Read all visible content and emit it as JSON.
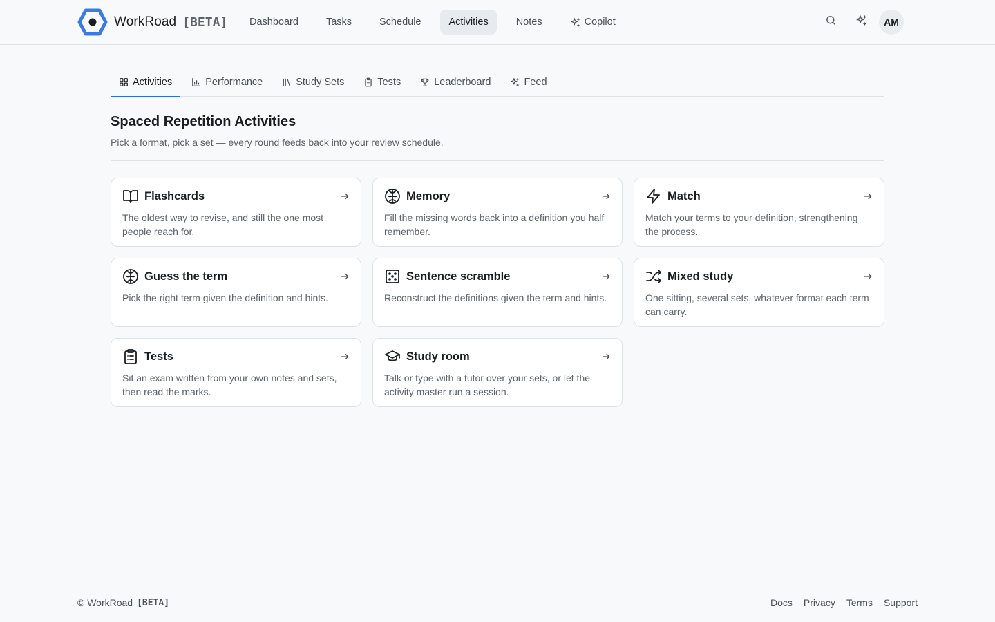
{
  "brand": {
    "name": "WorkRoad",
    "beta": "[BETA]",
    "logo_icon": "hexagon-logo",
    "accent": "#3b7be0"
  },
  "nav": {
    "items": [
      {
        "label": "Dashboard"
      },
      {
        "label": "Tasks"
      },
      {
        "label": "Schedule"
      },
      {
        "label": "Activities",
        "active": true
      },
      {
        "label": "Notes"
      },
      {
        "label": "Copilot",
        "icon": "sparkle-icon"
      }
    ]
  },
  "header_actions": {
    "search_icon": "search-icon",
    "ai_icon": "sparkle-icon",
    "avatar_initials": "AM"
  },
  "subtabs": [
    {
      "label": "Activities",
      "icon": "grid-icon",
      "active": true
    },
    {
      "label": "Performance",
      "icon": "bar-chart-icon"
    },
    {
      "label": "Study Sets",
      "icon": "library-icon"
    },
    {
      "label": "Tests",
      "icon": "clipboard-icon"
    },
    {
      "label": "Leaderboard",
      "icon": "trophy-icon"
    },
    {
      "label": "Feed",
      "icon": "sparkle-icon"
    }
  ],
  "section": {
    "title": "Spaced Repetition Activities",
    "subtitle": "Pick a format, pick a set — every round feeds back into your review schedule."
  },
  "cards": [
    {
      "title": "Flashcards",
      "icon": "book-open-icon",
      "desc": "The oldest way to revise, and still the one most people reach for."
    },
    {
      "title": "Memory",
      "icon": "brain-icon",
      "desc": "Fill the missing words back into a definition you half remember."
    },
    {
      "title": "Match",
      "icon": "lightning-icon",
      "desc": "Match your terms to your definition, strengthening the process."
    },
    {
      "title": "Guess the term",
      "icon": "brain-icon",
      "desc": "Pick the right term given the definition and hints."
    },
    {
      "title": "Sentence scramble",
      "icon": "scramble-icon",
      "desc": "Reconstruct the definitions given the term and hints."
    },
    {
      "title": "Mixed study",
      "icon": "shuffle-icon",
      "desc": "One sitting, several sets, whatever format each term can carry."
    },
    {
      "title": "Tests",
      "icon": "clipboard-list-icon",
      "desc": "Sit an exam written from your own notes and sets, then read the marks."
    },
    {
      "title": "Study room",
      "icon": "graduation-cap-icon",
      "desc": "Talk or type with a tutor over your sets, or let the activity master run a session."
    }
  ],
  "footer": {
    "copyright": "© WorkRoad",
    "beta": "[BETA]",
    "links": [
      "Docs",
      "Privacy",
      "Terms",
      "Support"
    ]
  }
}
